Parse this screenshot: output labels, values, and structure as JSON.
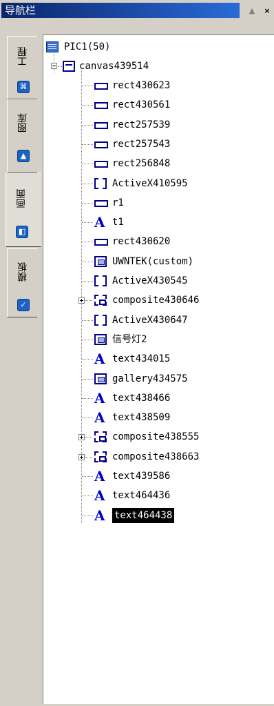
{
  "panel": {
    "title": "导航栏",
    "pin_icon": "pin-arrow-icon",
    "close_icon": "close-icon"
  },
  "side_tabs": [
    {
      "label": "工程",
      "icon": "project-icon"
    },
    {
      "label": "图库",
      "icon": "gallery-icon"
    },
    {
      "label": "画面",
      "icon": "screen-icon",
      "active": true
    },
    {
      "label": "模板",
      "icon": "template-icon"
    }
  ],
  "tree": {
    "root": {
      "label": "PIC1(50)",
      "icon": "picture-icon"
    },
    "canvas": {
      "label": "canvas439514",
      "icon": "canvas-icon",
      "expanded": true
    },
    "items": [
      {
        "label": "rect430623",
        "icon": "rect-icon"
      },
      {
        "label": "rect430561",
        "icon": "rect-icon"
      },
      {
        "label": "rect257539",
        "icon": "rect-icon"
      },
      {
        "label": "rect257543",
        "icon": "rect-icon"
      },
      {
        "label": "rect256848",
        "icon": "rect-icon"
      },
      {
        "label": "ActiveX410595",
        "icon": "activex-icon"
      },
      {
        "label": "r1",
        "icon": "rect-icon"
      },
      {
        "label": "t1",
        "icon": "text-icon"
      },
      {
        "label": "rect430620",
        "icon": "rect-icon"
      },
      {
        "label": "UWNTEK(custom)",
        "icon": "custom-icon"
      },
      {
        "label": "ActiveX430545",
        "icon": "activex-icon"
      },
      {
        "label": "composite430646",
        "icon": "composite-icon",
        "expandable": true
      },
      {
        "label": "ActiveX430647",
        "icon": "activex-icon"
      },
      {
        "label": "信号灯2",
        "icon": "custom-icon"
      },
      {
        "label": "text434015",
        "icon": "text-icon"
      },
      {
        "label": "gallery434575",
        "icon": "custom-icon"
      },
      {
        "label": "text438466",
        "icon": "text-icon"
      },
      {
        "label": "text438509",
        "icon": "text-icon"
      },
      {
        "label": "composite438555",
        "icon": "composite-icon",
        "expandable": true
      },
      {
        "label": "composite438663",
        "icon": "composite-icon",
        "expandable": true
      },
      {
        "label": "text439586",
        "icon": "text-icon"
      },
      {
        "label": "text464436",
        "icon": "text-icon"
      },
      {
        "label": "text464438",
        "icon": "text-icon",
        "selected": true
      }
    ]
  }
}
